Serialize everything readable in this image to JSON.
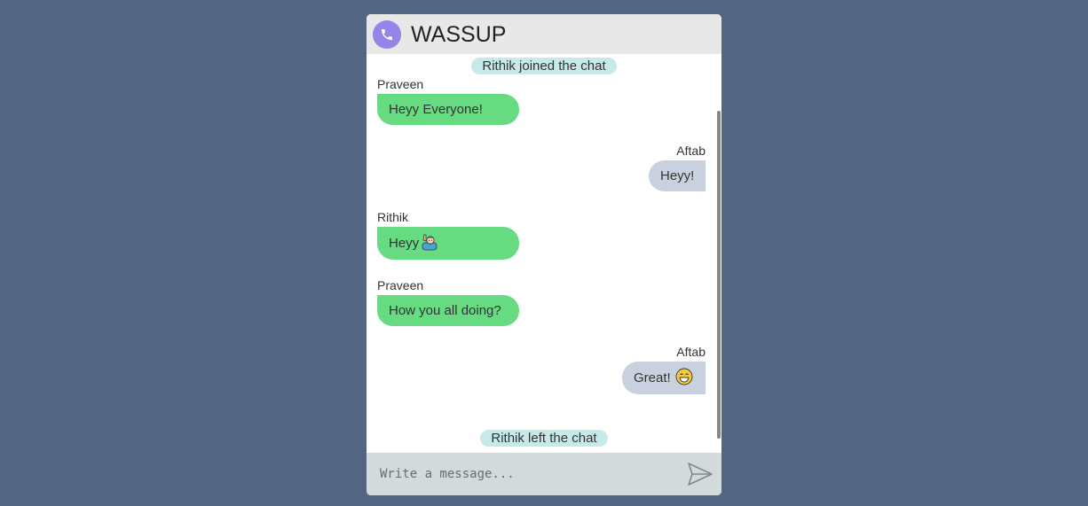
{
  "app": {
    "title": "WASSUP",
    "logo_icon": "phone-icon",
    "logo_color": "#9485e8"
  },
  "messages": [
    {
      "type": "system",
      "text": "Rithik joined the chat"
    },
    {
      "type": "incoming",
      "sender": "Praveen",
      "text": "Heyy Everyone!"
    },
    {
      "type": "outgoing",
      "sender": "Aftab",
      "text": "Heyy!"
    },
    {
      "type": "incoming",
      "sender": "Rithik",
      "text": "Heyy",
      "emoji": "person-raising-hand-emoji"
    },
    {
      "type": "incoming",
      "sender": "Praveen",
      "text": "How you all doing?"
    },
    {
      "type": "outgoing",
      "sender": "Aftab",
      "text": "Great!",
      "emoji": "grinning-face-emoji"
    },
    {
      "type": "system",
      "text": "Rithik left the chat"
    }
  ],
  "composer": {
    "placeholder": "Write a message...",
    "send_icon": "send-icon"
  },
  "colors": {
    "background": "#536583",
    "incoming_bubble": "#66db82",
    "outgoing_bubble": "#c9d1de",
    "system_pill": "#c6e9ea",
    "header": "#e8e8e8",
    "composer": "#d2dadc"
  }
}
